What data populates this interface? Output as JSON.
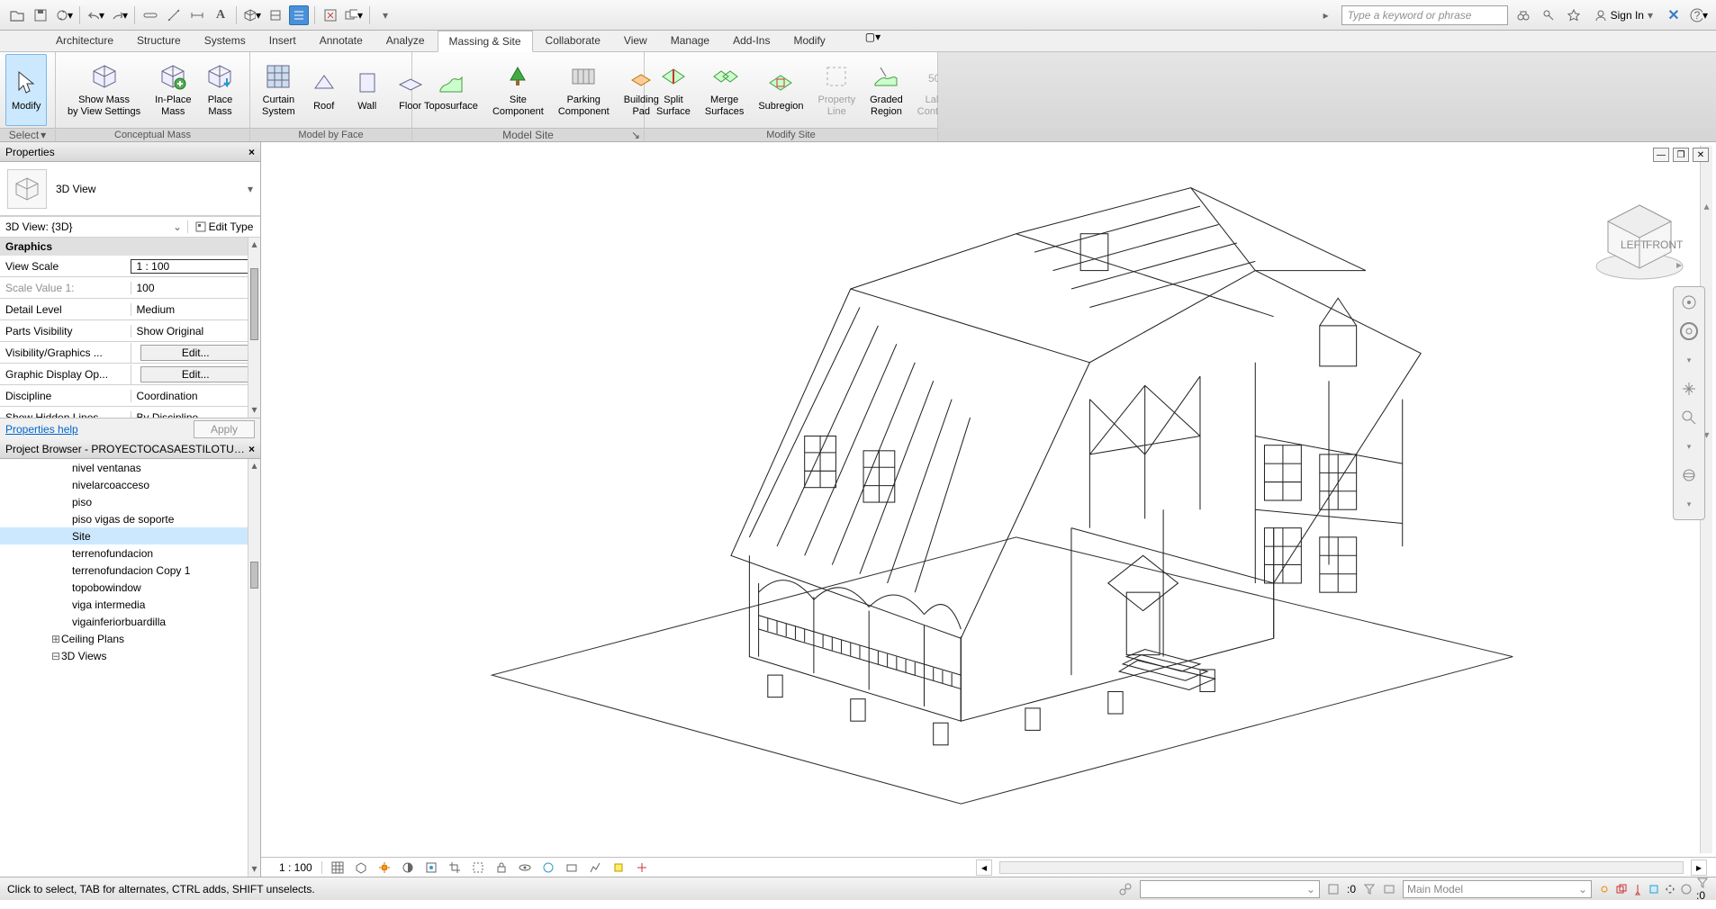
{
  "qat": {
    "search_placeholder": "Type a keyword or phrase",
    "signin": "Sign In"
  },
  "tabs": [
    "Architecture",
    "Structure",
    "Systems",
    "Insert",
    "Annotate",
    "Analyze",
    "Massing & Site",
    "Collaborate",
    "View",
    "Manage",
    "Add-Ins",
    "Modify"
  ],
  "active_tab": "Massing & Site",
  "ribbon": {
    "select": {
      "label": "Select",
      "modify": "Modify"
    },
    "panels": [
      {
        "title": "Conceptual Mass",
        "buttons": [
          {
            "id": "show-mass",
            "label": "Show Mass\nby View Settings",
            "ico": "cube"
          },
          {
            "id": "inplace-mass",
            "label": "In-Place\nMass",
            "ico": "cube-plus"
          },
          {
            "id": "place-mass",
            "label": "Place\nMass",
            "ico": "cube-down"
          }
        ]
      },
      {
        "title": "Model by Face",
        "buttons": [
          {
            "id": "curtain-system",
            "label": "Curtain\nSystem",
            "ico": "grid"
          },
          {
            "id": "roof",
            "label": "Roof",
            "ico": "roof"
          },
          {
            "id": "wall",
            "label": "Wall",
            "ico": "wall"
          },
          {
            "id": "floor",
            "label": "Floor",
            "ico": "floor"
          }
        ]
      },
      {
        "title": "Model Site",
        "exp": true,
        "buttons": [
          {
            "id": "toposurface",
            "label": "Toposurface",
            "ico": "topo"
          },
          {
            "id": "site-component",
            "label": "Site\nComponent",
            "ico": "tree"
          },
          {
            "id": "parking-component",
            "label": "Parking\nComponent",
            "ico": "parking"
          },
          {
            "id": "building-pad",
            "label": "Building\nPad",
            "ico": "pad"
          }
        ]
      },
      {
        "title": "Modify Site",
        "buttons": [
          {
            "id": "split-surface",
            "label": "Split\nSurface",
            "ico": "split"
          },
          {
            "id": "merge-surfaces",
            "label": "Merge\nSurfaces",
            "ico": "merge"
          },
          {
            "id": "subregion",
            "label": "Subregion",
            "ico": "sub"
          },
          {
            "id": "property-line",
            "label": "Property\nLine",
            "ico": "pline",
            "disabled": true
          },
          {
            "id": "graded-region",
            "label": "Graded\nRegion",
            "ico": "graded"
          },
          {
            "id": "label-contours",
            "label": "Label\nContours",
            "ico": "label",
            "disabled": true
          }
        ]
      }
    ]
  },
  "properties": {
    "title": "Properties",
    "type": "3D View",
    "instance": "3D View: {3D}",
    "edit_type": "Edit Type",
    "section": "Graphics",
    "rows": [
      {
        "k": "View Scale",
        "v": "1 : 100",
        "input": true
      },
      {
        "k": "Scale Value    1:",
        "v": "100",
        "gray": true
      },
      {
        "k": "Detail Level",
        "v": "Medium"
      },
      {
        "k": "Parts Visibility",
        "v": "Show Original"
      },
      {
        "k": "Visibility/Graphics ...",
        "v": "Edit...",
        "btn": true
      },
      {
        "k": "Graphic Display Op...",
        "v": "Edit...",
        "btn": true
      },
      {
        "k": "Discipline",
        "v": "Coordination"
      },
      {
        "k": "Show Hidden Lines",
        "v": "By Discipline",
        "cut": true
      }
    ],
    "help": "Properties help",
    "apply": "Apply"
  },
  "browser": {
    "title": "Project Browser - PROYECTOCASAESTILOTUDOR...",
    "items": [
      "nivel ventanas",
      "nivelarcoacceso",
      "piso",
      "piso  vigas de soporte",
      "Site",
      "terrenofundacion",
      "terrenofundacion Copy 1",
      "topobowindow",
      "viga intermedia",
      "vigainferiorbuardilla"
    ],
    "selected": "Site",
    "groups": [
      {
        "label": "Ceiling Plans",
        "icon": "plus"
      },
      {
        "label": "3D Views",
        "icon": "minus"
      }
    ]
  },
  "view_status": {
    "scale": "1 : 100"
  },
  "status": {
    "hint": "Click to select, TAB for alternates, CTRL adds, SHIFT unselects.",
    "zero": ":0",
    "workset": "Main Model"
  },
  "viewcube": {
    "left": "LEFT",
    "front": "FRONT"
  }
}
